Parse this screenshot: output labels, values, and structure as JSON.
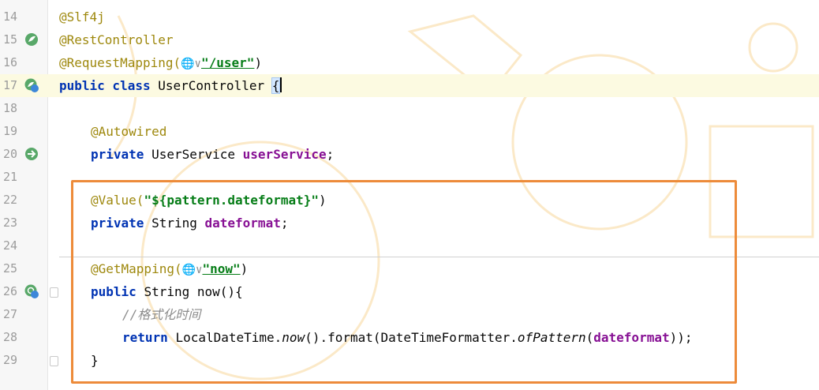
{
  "editor": {
    "lines": [
      {
        "num": "14"
      },
      {
        "num": "15"
      },
      {
        "num": "16"
      },
      {
        "num": "17"
      },
      {
        "num": "18"
      },
      {
        "num": "19"
      },
      {
        "num": "20"
      },
      {
        "num": "21"
      },
      {
        "num": "22"
      },
      {
        "num": "23"
      },
      {
        "num": "24"
      },
      {
        "num": "25"
      },
      {
        "num": "26"
      },
      {
        "num": "27"
      },
      {
        "num": "28"
      },
      {
        "num": "29"
      }
    ],
    "code": {
      "l14": {
        "annotation": "@Slf4j"
      },
      "l15": {
        "annotation": "@RestController"
      },
      "l16": {
        "annotation": "@RequestMapping(",
        "url": "\"/user\"",
        "close": ")"
      },
      "l17": {
        "kw": "public class ",
        "name": "UserController ",
        "brace": "{"
      },
      "l19": {
        "annotation": "@Autowired"
      },
      "l20": {
        "kw": "private ",
        "type": "UserService ",
        "field": "userService",
        "end": ";"
      },
      "l22": {
        "annotation": "@Value(",
        "str": "\"${pattern.dateformat}\"",
        "close": ")"
      },
      "l23": {
        "kw": "private ",
        "type": "String ",
        "field": "dateformat",
        "end": ";"
      },
      "l25": {
        "annotation": "@GetMapping(",
        "url": "\"now\"",
        "close": ")"
      },
      "l26": {
        "kw": "public ",
        "rest": "String now(){"
      },
      "l27": {
        "comment": "//格式化时间"
      },
      "l28": {
        "kw": "return ",
        "a": "LocalDateTime.",
        "b": "now",
        "c": "().format(DateTimeFormatter.",
        "d": "ofPattern",
        "e": "(",
        "f": "dateformat",
        "g": "));"
      },
      "l29": {
        "text": "}"
      }
    },
    "gutter_icons": {
      "l15": "bean-icon",
      "l17": "bean-class-icon",
      "l20": "autowired-bean-icon",
      "l26": "mapping-icon"
    },
    "colors": {
      "keyword": "#0033b3",
      "annotation": "#9e880d",
      "string": "#067d17",
      "field": "#871094",
      "comment": "#8c8c8c",
      "highlight_box": "#ed8b3a",
      "current_line": "#fcfae1"
    }
  }
}
